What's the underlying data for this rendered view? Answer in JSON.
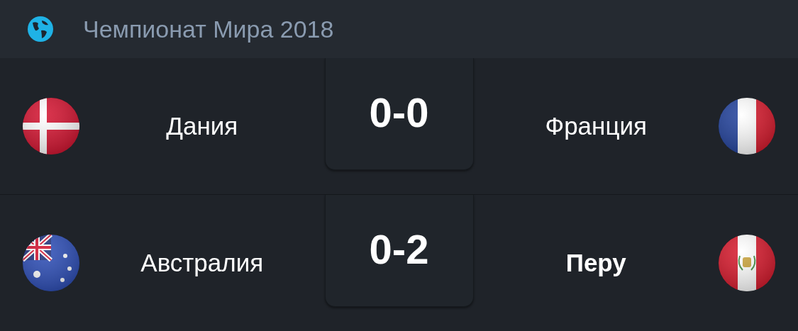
{
  "header": {
    "title": "Чемпионат Мира 2018"
  },
  "matches": [
    {
      "home": {
        "name": "Дания",
        "kind": "dk",
        "winner": false
      },
      "score": "0-0",
      "away": {
        "name": "Франция",
        "kind": "fr",
        "winner": false
      }
    },
    {
      "home": {
        "name": "Австралия",
        "kind": "au",
        "winner": false
      },
      "score": "0-2",
      "away": {
        "name": "Перу",
        "kind": "pe",
        "winner": true
      }
    }
  ]
}
